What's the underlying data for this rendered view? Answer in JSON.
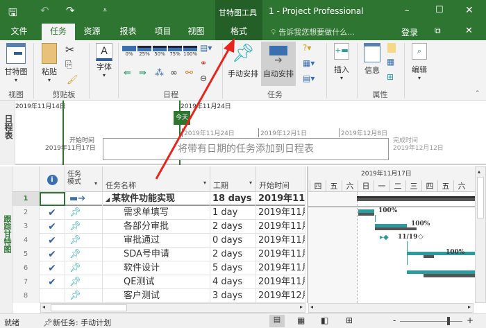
{
  "titlebar": {
    "context_tool": "甘特图工具",
    "title": "1 - Project Professional"
  },
  "tabs": [
    {
      "label": "文件"
    },
    {
      "label": "任务"
    },
    {
      "label": "资源"
    },
    {
      "label": "报表"
    },
    {
      "label": "项目"
    },
    {
      "label": "视图"
    },
    {
      "label": "格式"
    }
  ],
  "tell_me": "告诉我您想要做什么...",
  "signin": "登录",
  "ribbon": {
    "gantt": "甘特图",
    "view_group": "视图",
    "paste": "粘贴",
    "clipboard_group": "剪贴板",
    "font": "字体",
    "percent_buttons": [
      "0%",
      "25%",
      "50%",
      "75%",
      "100%"
    ],
    "schedule_group": "日程",
    "manual": "手动安排",
    "auto": "自动安排",
    "task_group": "任务",
    "insert": "插入",
    "info": "信息",
    "properties_group": "属性",
    "edit": "编辑"
  },
  "timeline": {
    "side_label": "日程表",
    "date_left": "2019年11月14日",
    "date_top": "2019年11月24日",
    "today_marker": "今天",
    "ticks": [
      "2019年11月24日",
      "2019年12月1日",
      "2019年12月8日"
    ],
    "start_label": "开始时间",
    "start_date": "2019年11月17日",
    "finish_label": "完成时间",
    "finish_date": "2019年12月12日",
    "placeholder": "将带有日期的任务添加到日程表"
  },
  "side_view_label": "跟踪甘特图",
  "table": {
    "headers": {
      "mode": "任务\n模式",
      "name": "任务名称",
      "duration": "工期",
      "start": "开始时间"
    },
    "rows": [
      {
        "id": "1",
        "done": false,
        "name": "某软件功能实现",
        "duration": "18 days",
        "start": "2019年11月",
        "summary": true
      },
      {
        "id": "2",
        "done": true,
        "name": "需求单填写",
        "duration": "1 day",
        "start": "2019年11月"
      },
      {
        "id": "3",
        "done": true,
        "name": "各部分审批",
        "duration": "2 days",
        "start": "2019年11月"
      },
      {
        "id": "4",
        "done": true,
        "name": "审批通过",
        "duration": "0 days",
        "start": "2019年11月"
      },
      {
        "id": "5",
        "done": true,
        "name": "SDA号申请",
        "duration": "2 days",
        "start": "2019年11月"
      },
      {
        "id": "6",
        "done": true,
        "name": "软件设计",
        "duration": "5 days",
        "start": "2019年11月"
      },
      {
        "id": "7",
        "done": true,
        "name": "QE测试",
        "duration": "4 days",
        "start": "2019年11月"
      },
      {
        "id": "8",
        "done": false,
        "name": "客户测试",
        "duration": "3 days",
        "start": "2019年12月"
      }
    ]
  },
  "gantt": {
    "week_label": "2019年11月17日",
    "days": [
      "四",
      "五",
      "六",
      "日",
      "一",
      "二",
      "三",
      "四",
      "五",
      "六"
    ],
    "labels": [
      "100%",
      "100%",
      "11/19",
      "100%"
    ]
  },
  "status": {
    "ready": "就绪",
    "new_task": "新任务: 手动计划"
  },
  "colors": {
    "brand": "#2e7532",
    "bar": "#2a9ca0",
    "baseline": "#5a5a5a",
    "arrow": "#e8241c"
  }
}
